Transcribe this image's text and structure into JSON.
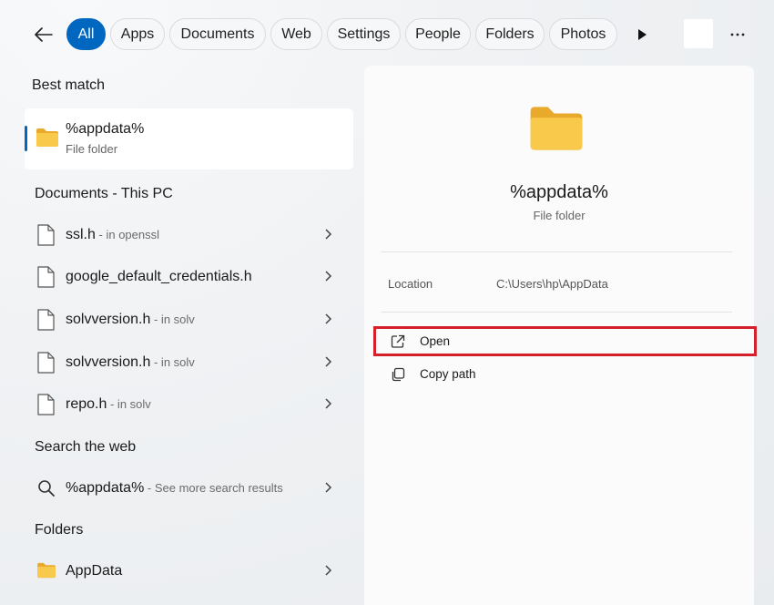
{
  "filters": {
    "back": "back-arrow-icon",
    "chips": [
      {
        "label": "All",
        "active": true
      },
      {
        "label": "Apps"
      },
      {
        "label": "Documents"
      },
      {
        "label": "Web"
      },
      {
        "label": "Settings"
      },
      {
        "label": "People"
      },
      {
        "label": "Folders"
      },
      {
        "label": "Photos"
      }
    ]
  },
  "best_match": {
    "heading": "Best match",
    "title": "%appdata%",
    "subtitle": "File folder"
  },
  "documents": {
    "heading": "Documents - This PC",
    "items": [
      {
        "name": "ssl.h",
        "location": " - in openssl"
      },
      {
        "name": "google_default_credentials.h",
        "location": ""
      },
      {
        "name": "solvversion.h",
        "location": " - in solv"
      },
      {
        "name": "solvversion.h",
        "location": " - in solv"
      },
      {
        "name": "repo.h",
        "location": " - in solv"
      }
    ]
  },
  "web": {
    "heading": "Search the web",
    "query": "%appdata%",
    "hint": " - See more search results"
  },
  "folders": {
    "heading": "Folders",
    "items": [
      {
        "name": "AppData"
      }
    ]
  },
  "preview": {
    "title": "%appdata%",
    "subtitle": "File folder",
    "location_label": "Location",
    "location_value": "C:\\Users\\hp\\AppData",
    "actions": [
      {
        "label": "Open",
        "icon": "open-external-icon"
      },
      {
        "label": "Copy path",
        "icon": "copy-icon"
      }
    ]
  },
  "colors": {
    "accent": "#0067c0",
    "highlight": "#d4202a",
    "folder": "#f8c94a"
  }
}
